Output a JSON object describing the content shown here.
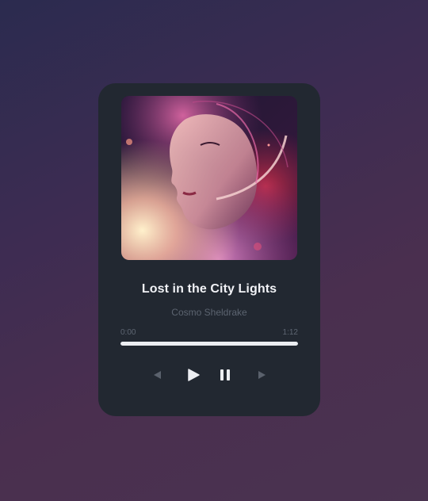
{
  "track": {
    "title": "Lost in the City Lights",
    "artist": "Cosmo Sheldrake"
  },
  "progress": {
    "current_time": "0:00",
    "total_time": "1:12",
    "fraction": 1.0
  },
  "controls": {
    "previous_icon": "previous-icon",
    "play_icon": "play-icon",
    "pause_icon": "pause-icon",
    "next_icon": "next-icon"
  },
  "colors": {
    "card": "#222831",
    "title": "#f1f2f6",
    "artist": "#5c6470",
    "progress_fill": "#eceef2",
    "icon_active": "#eceef2",
    "icon_muted": "#5a616c"
  }
}
